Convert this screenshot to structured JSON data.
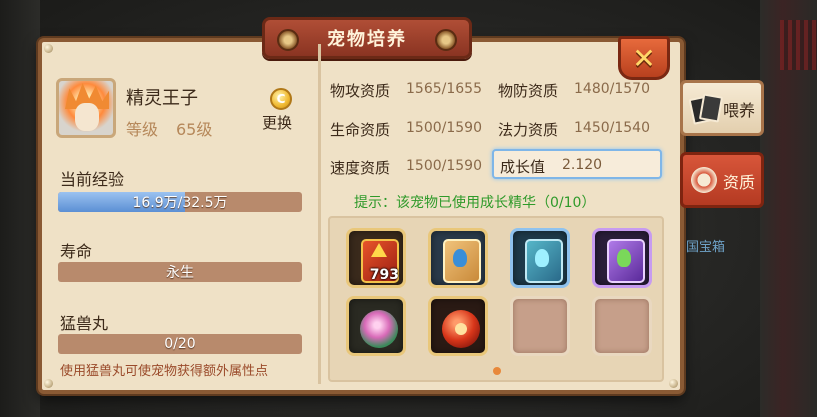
{
  "window": {
    "title": "宠物培养"
  },
  "pet": {
    "name": "精灵王子",
    "level_label": "等级",
    "level_value": "65级",
    "change_label": "更换",
    "change_icon_glyph": "C"
  },
  "left": {
    "exp_label": "当前经验",
    "exp_text": "16.9万/32.5万",
    "exp_progress": 0.52,
    "life_label": "寿命",
    "life_value": "永生",
    "pill_label": "猛兽丸",
    "pill_text": "0/20",
    "pill_progress": 0.0,
    "pill_hint": "使用猛兽丸可使宠物获得额外属性点"
  },
  "stats": {
    "items": [
      {
        "label": "物攻资质",
        "value": "1565/1655"
      },
      {
        "label": "物防资质",
        "value": "1480/1570"
      },
      {
        "label": "生命资质",
        "value": "1500/1590"
      },
      {
        "label": "法力资质",
        "value": "1450/1540"
      },
      {
        "label": "速度资质",
        "value": "1500/1590"
      }
    ],
    "growth_label": "成长值",
    "growth_value": "2.120"
  },
  "hint": "提示：该宠物已使用成长精华（0/10）",
  "items": {
    "slot0_count": "793"
  },
  "side": {
    "feed_label": "喂养",
    "aptitude_label": "资质",
    "treasure_text": "国宝箱"
  },
  "close_glyph": "✕",
  "colors": {
    "panel": "#efe1c6",
    "frame": "#8a5a34",
    "title_bar": "#a0432c",
    "hint_green": "#2f9a2a",
    "exp_blue": "#5b8fd4",
    "bar_brown": "#b88a6c",
    "growth_border": "#7fb6e8"
  }
}
